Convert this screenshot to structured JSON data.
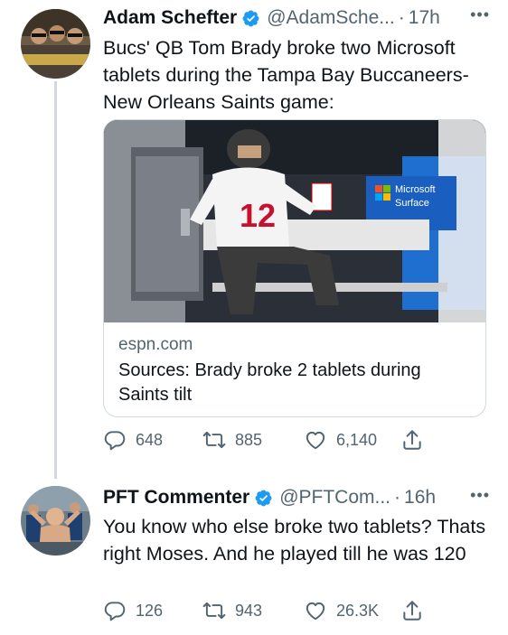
{
  "tweets": [
    {
      "name": "Adam Schefter",
      "handle": "@AdamSche...",
      "time": "17h",
      "text": "Bucs' QB Tom Brady broke two Microsoft tablets during the Tampa Bay Buccaneers-New Orleans Saints game:",
      "card": {
        "domain": "espn.com",
        "title": "Sources: Brady broke 2 tablets during Saints tilt",
        "image": {
          "jersey_number": "12",
          "sign_text": [
            "Microsoft",
            "Surface"
          ]
        }
      },
      "replies": "648",
      "retweets": "885",
      "likes": "6,140"
    },
    {
      "name": "PFT Commenter",
      "handle": "@PFTCom...",
      "time": "16h",
      "text": "You know who else broke two tablets? Thats right Moses. And he played till he was 120",
      "replies": "126",
      "retweets": "943",
      "likes": "26.3K"
    }
  ],
  "more_glyph": "•••",
  "dot": "·",
  "icons": [
    "verified-badge-icon",
    "reply-icon",
    "retweet-icon",
    "like-icon",
    "share-icon",
    "more-icon"
  ],
  "colors": {
    "verified": "#1d9bf0",
    "secondary": "#536471",
    "border": "#cfd9de",
    "text": "#0f1419"
  }
}
